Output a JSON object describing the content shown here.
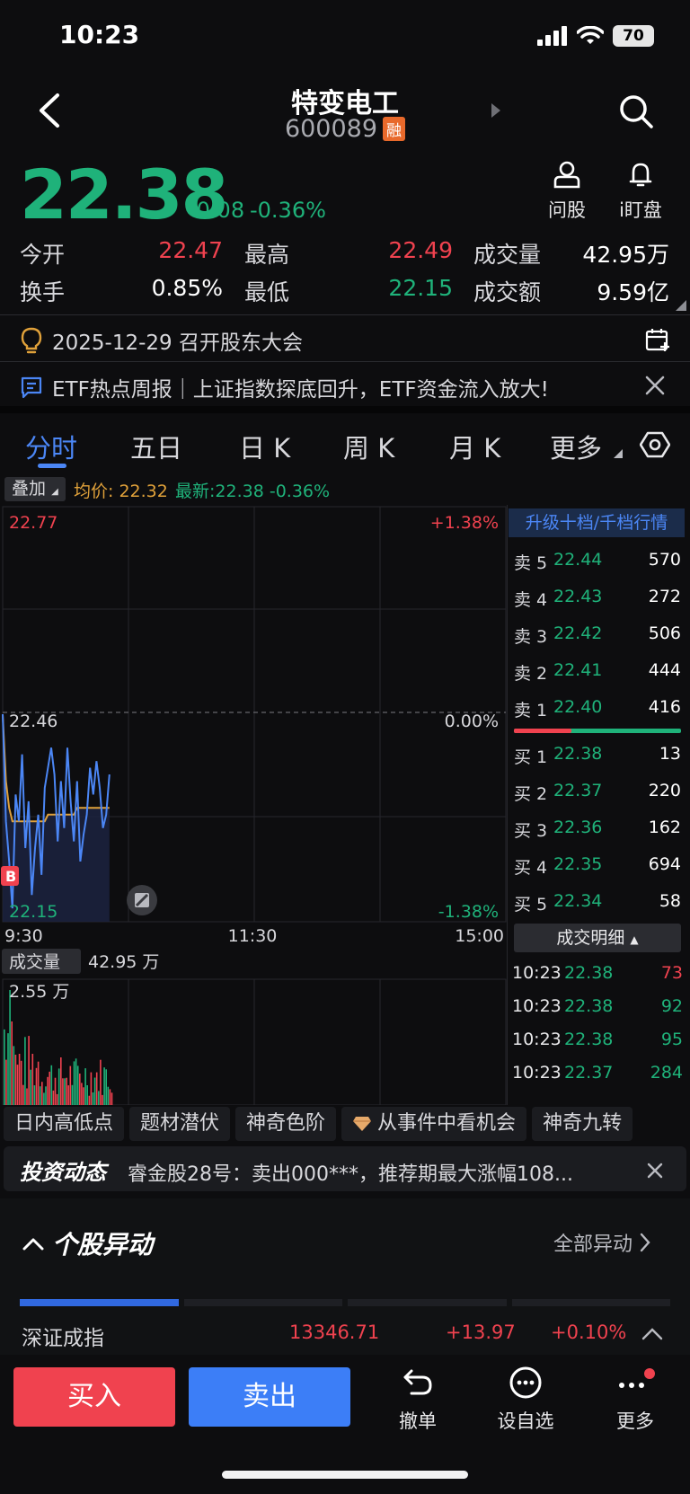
{
  "status": {
    "time": "10:23",
    "battery": "70"
  },
  "header": {
    "name": "特变电工",
    "code": "600089",
    "badge": "融"
  },
  "price": {
    "last": "22.38",
    "change": "-0.08",
    "change_pct": "-0.36%"
  },
  "actions": {
    "ask": "问股",
    "monitor": "i盯盘"
  },
  "stats": {
    "open_label": "今开",
    "open": "22.47",
    "high_label": "最高",
    "high": "22.49",
    "volume_label": "成交量",
    "volume": "42.95万",
    "turnover_label": "换手",
    "turnover": "0.85%",
    "low_label": "最低",
    "low": "22.15",
    "amount_label": "成交额",
    "amount": "9.59亿"
  },
  "notice": {
    "text": "2025-12-29 召开股东大会"
  },
  "etf": {
    "text": "ETF热点周报｜上证指数探底回升，ETF资金流入放大!"
  },
  "tabs": [
    {
      "label": "分时",
      "active": true
    },
    {
      "label": "五日"
    },
    {
      "label": "日 K"
    },
    {
      "label": "周 K"
    },
    {
      "label": "月 K"
    },
    {
      "label": "更多"
    }
  ],
  "overlay": {
    "label": "叠加",
    "avg": "均价: 22.32",
    "latest": "最新:22.38 -0.36%"
  },
  "chart": {
    "top_price": "22.77",
    "top_pct": "+1.38%",
    "mid_price": "22.46",
    "mid_pct": "0.00%",
    "bot_price": "22.15",
    "bot_pct": "-1.38%",
    "times": [
      "9:30",
      "11:30",
      "15:00"
    ],
    "b_marker": "B",
    "volume_label": "成交量",
    "volume_total": "42.95 万",
    "volume_max": "2.55 万"
  },
  "chart_data": {
    "type": "line",
    "title": "",
    "x": [
      "9:30",
      "11:30",
      "15:00"
    ],
    "ylim": [
      22.15,
      22.77
    ],
    "series": [
      {
        "name": "",
        "values": [
          22.46,
          22.3,
          22.24,
          22.17,
          22.34,
          22.3,
          22.4,
          22.26,
          22.33,
          22.19,
          22.26,
          22.31,
          22.22,
          22.35,
          22.38,
          22.41,
          22.37,
          22.27,
          22.36,
          22.29,
          22.41,
          22.33,
          22.27,
          22.36,
          22.24,
          22.28,
          22.31,
          22.38,
          22.34,
          22.39,
          22.35,
          22.29,
          22.31,
          22.37
        ]
      },
      {
        "name": "均价",
        "values": [
          22.46,
          22.36,
          22.32,
          22.3,
          22.3,
          22.3,
          22.3,
          22.3,
          22.3,
          22.3,
          22.3,
          22.3,
          22.3,
          22.3,
          22.31,
          22.31,
          22.31,
          22.31,
          22.31,
          22.31,
          22.31,
          22.31,
          22.31,
          22.32,
          22.32,
          22.32,
          22.32,
          22.32,
          22.32,
          22.32,
          22.32,
          22.32,
          22.32,
          22.32
        ]
      }
    ]
  },
  "orderbook": {
    "upgrade": "升级十档/千档行情",
    "asks": [
      {
        "label": "卖 5",
        "price": "22.44",
        "vol": "570"
      },
      {
        "label": "卖 4",
        "price": "22.43",
        "vol": "272"
      },
      {
        "label": "卖 3",
        "price": "22.42",
        "vol": "506"
      },
      {
        "label": "卖 2",
        "price": "22.41",
        "vol": "444"
      },
      {
        "label": "卖 1",
        "price": "22.40",
        "vol": "416"
      }
    ],
    "bids": [
      {
        "label": "买 1",
        "price": "22.38",
        "vol": "13"
      },
      {
        "label": "买 2",
        "price": "22.37",
        "vol": "220"
      },
      {
        "label": "买 3",
        "price": "22.36",
        "vol": "162"
      },
      {
        "label": "买 4",
        "price": "22.35",
        "vol": "694"
      },
      {
        "label": "买 5",
        "price": "22.34",
        "vol": "58"
      }
    ],
    "detail_label": "成交明细",
    "trades": [
      {
        "time": "10:23",
        "price": "22.38",
        "vol": "73",
        "side": "sell"
      },
      {
        "time": "10:23",
        "price": "22.38",
        "vol": "92",
        "side": "buy"
      },
      {
        "time": "10:23",
        "price": "22.38",
        "vol": "95",
        "side": "buy"
      },
      {
        "time": "10:23",
        "price": "22.37",
        "vol": "284",
        "side": "buy"
      }
    ]
  },
  "chips": [
    "日内高低点",
    "题材潜伏",
    "神奇色阶",
    "从事件中看机会",
    "神奇九转"
  ],
  "dynamic": {
    "title": "投资动态",
    "text": "睿金股28号：卖出000***，推荐期最大涨幅108..."
  },
  "section": {
    "title": "个股异动",
    "all": "全部异动"
  },
  "ticker": {
    "name": "深证成指",
    "value": "13346.71",
    "change": "+13.97",
    "pct": "+0.10%"
  },
  "bottom": {
    "buy": "买入",
    "sell": "卖出",
    "cancel": "撤单",
    "watch": "设自选",
    "more": "更多"
  },
  "colors": {
    "up": "#f0424f",
    "down": "#1fb27a",
    "accent": "#4b86f5",
    "avg": "#e0a13a"
  }
}
